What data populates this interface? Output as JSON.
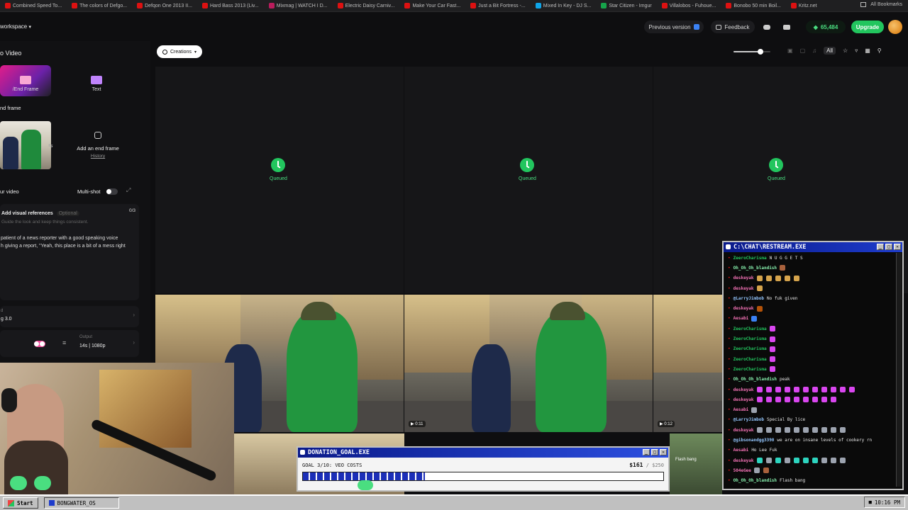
{
  "bookmarks": {
    "items": [
      {
        "label": "Combined Speed To...",
        "color": "#d11"
      },
      {
        "label": "The colors of Defgo...",
        "color": "#d11"
      },
      {
        "label": "Defqon One 2013 II...",
        "color": "#d11"
      },
      {
        "label": "Hard Bass 2013 (Liv...",
        "color": "#d11"
      },
      {
        "label": "Mixmag | WATCH I D...",
        "color": "#b91c5c"
      },
      {
        "label": "Electric Daisy Carniv...",
        "color": "#d11"
      },
      {
        "label": "Make Your Car Fast...",
        "color": "#d11"
      },
      {
        "label": "Just a Bit Fortress -...",
        "color": "#d11"
      },
      {
        "label": "Mixed In Key - DJ S...",
        "color": "#0ea5e9"
      },
      {
        "label": "Star Citizen - Imgur",
        "color": "#16a34a"
      },
      {
        "label": "Villalobos - Fuhoue...",
        "color": "#d11"
      },
      {
        "label": "Bonobo 50 min Boil...",
        "color": "#d11"
      },
      {
        "label": "Kritz.net",
        "color": "#d11"
      }
    ],
    "all_label": "All Bookmarks"
  },
  "appbar": {
    "workspace": "workspace",
    "previous_version": "Previous version",
    "feedback": "Feedback",
    "credits": "65,484",
    "upgrade": "Upgrade"
  },
  "leftpanel": {
    "title": "o Video",
    "tab_frame": "/End Frame",
    "tab_text": "Text",
    "end_frame_label": "nd frame",
    "add_end_frame": "Add an end frame",
    "history": "History",
    "your_video": "ur video",
    "multi_shot": "Multi-shot",
    "add_visual_refs": "Add visual references",
    "optional": "Optional",
    "refs_count": "0/3",
    "refs_desc": "Guide the look and keep things consistent.",
    "prompt_line1": "patient of a news reporter with a good speaking voice",
    "prompt_line2": "h giving a report, \"Yeah, this place is a bit of a mess right",
    "model_label": "d",
    "model_value": "g 3.0",
    "output_label": "Output",
    "output_value": "14s | 1080p"
  },
  "toolbar": {
    "creations": "Creations",
    "slider_value": 0.73,
    "all": "All"
  },
  "grid": {
    "queued_label": "Queued",
    "durations": [
      "0:11",
      "0:12"
    ]
  },
  "chat": {
    "title": "C:\\CHAT\\RESTREAM.EXE",
    "lines": [
      {
        "user": "ZeeroCharisma",
        "msg": "N U G G E T S",
        "color": "#22c55e",
        "emotes": []
      },
      {
        "user": "Oh_Oh_Oh_blandish",
        "msg": "",
        "color": "#86efac",
        "emotes": [
          "#a8613c"
        ]
      },
      {
        "user": "deskeyak",
        "msg": "",
        "color": "#f472b6",
        "emotes": [
          "#d6a44c",
          "#d6a44c",
          "#d6a44c",
          "#d6a44c",
          "#d6a44c"
        ]
      },
      {
        "user": "deskeyak",
        "msg": "",
        "color": "#f472b6",
        "emotes": [
          "#d6a44c"
        ]
      },
      {
        "user": "@LarryJimbob",
        "msg": "No fuk given",
        "color": "#93c5fd",
        "emotes": []
      },
      {
        "user": "deskeyak",
        "msg": "",
        "color": "#f472b6",
        "emotes": [
          "#b45309"
        ]
      },
      {
        "user": "Aesabi",
        "msg": "",
        "color": "#f472b6",
        "emotes": [
          "#3b82f6"
        ]
      },
      {
        "user": "ZeeroCharisma",
        "msg": "",
        "color": "#22c55e",
        "emotes": [
          "#d946ef"
        ]
      },
      {
        "user": "ZeeroCharisma",
        "msg": "",
        "color": "#22c55e",
        "emotes": [
          "#d946ef"
        ]
      },
      {
        "user": "ZeeroCharisma",
        "msg": "",
        "color": "#22c55e",
        "emotes": [
          "#d946ef"
        ]
      },
      {
        "user": "ZeeroCharisma",
        "msg": "",
        "color": "#22c55e",
        "emotes": [
          "#d946ef"
        ]
      },
      {
        "user": "ZeeroCharisma",
        "msg": "",
        "color": "#22c55e",
        "emotes": [
          "#d946ef"
        ]
      },
      {
        "user": "Oh_Oh_Oh_blandish",
        "msg": "peak",
        "color": "#86efac",
        "emotes": []
      },
      {
        "user": "deskeyak",
        "msg": "",
        "color": "#f472b6",
        "emotes": [
          "#d946ef",
          "#d946ef",
          "#d946ef",
          "#d946ef",
          "#d946ef",
          "#d946ef",
          "#d946ef",
          "#d946ef",
          "#d946ef",
          "#d946ef",
          "#d946ef"
        ]
      },
      {
        "user": "deskeyak",
        "msg": "",
        "color": "#f472b6",
        "emotes": [
          "#d946ef",
          "#d946ef",
          "#d946ef",
          "#d946ef",
          "#d946ef",
          "#d946ef",
          "#d946ef",
          "#d946ef",
          "#d946ef"
        ]
      },
      {
        "user": "Aesabi",
        "msg": "",
        "color": "#f472b6",
        "emotes": [
          "#9ca3af"
        ]
      },
      {
        "user": "@LarryJimbob",
        "msg": "Special By lice",
        "color": "#93c5fd",
        "emotes": []
      },
      {
        "user": "deskeyak",
        "msg": "",
        "color": "#f472b6",
        "emotes": [
          "#9ca3af",
          "#9ca3af",
          "#9ca3af",
          "#9ca3af",
          "#9ca3af",
          "#9ca3af",
          "#9ca3af",
          "#9ca3af",
          "#9ca3af",
          "#9ca3af"
        ]
      },
      {
        "user": "@gibsonandgg3390",
        "msg": "we are on insane levels of cookery rn",
        "color": "#93c5fd",
        "emotes": []
      },
      {
        "user": "Aesabi",
        "msg": "Ho Lee Fuk",
        "color": "#f472b6",
        "emotes": []
      },
      {
        "user": "deskeyak",
        "msg": "",
        "color": "#f472b6",
        "emotes": [
          "#2dd4bf",
          "#9ca3af",
          "#2dd4bf",
          "#9ca3af",
          "#2dd4bf",
          "#2dd4bf",
          "#2dd4bf",
          "#9ca3af",
          "#9ca3af",
          "#9ca3af"
        ]
      },
      {
        "user": "504eGee",
        "msg": "",
        "color": "#f472b6",
        "emotes": [
          "#9ca3af",
          "#a8613c"
        ]
      },
      {
        "user": "Oh_Oh_Oh_blandish",
        "msg": "Flash bang",
        "color": "#86efac",
        "emotes": []
      }
    ]
  },
  "donation": {
    "title": "DONATION_GOAL.EXE",
    "goal_text": "GOAL 3/10: VEO COSTS",
    "current": "$161",
    "target": "/ $250",
    "progress": 0.644
  },
  "stream_overlay": {
    "flash_text": "Flash bang"
  },
  "taskbar": {
    "start": "Start",
    "app": "BONGWATER_OS",
    "clock": "10:16 PM"
  }
}
